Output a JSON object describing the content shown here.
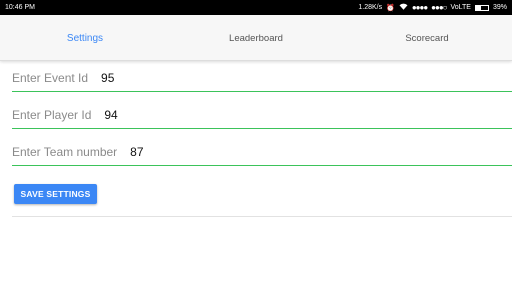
{
  "status_bar": {
    "time": "10:46 PM",
    "net_speed": "1.28K/s",
    "signal_1": "●●●●",
    "signal_2": "●●●○",
    "carrier": "VoLTE",
    "battery": "39%"
  },
  "tabs": [
    {
      "label": "Settings",
      "active": true
    },
    {
      "label": "Leaderboard",
      "active": false
    },
    {
      "label": "Scorecard",
      "active": false
    }
  ],
  "fields": {
    "event": {
      "label": "Enter Event Id",
      "value": "95"
    },
    "player": {
      "label": "Enter Player Id",
      "value": "94"
    },
    "team": {
      "label": "Enter Team number",
      "value": "87"
    }
  },
  "save_button": {
    "label": "SAVE SETTINGS"
  },
  "colors": {
    "accent": "#3b87f5",
    "field_underline": "#3bc35a"
  },
  "icons": [
    "alarm-icon",
    "wifi-icon",
    "battery-icon"
  ]
}
